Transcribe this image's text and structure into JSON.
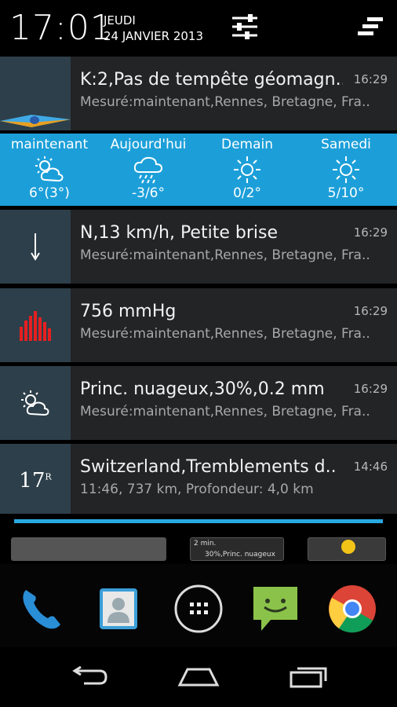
{
  "status": {
    "time": "17:01",
    "weekday": "JEUDI",
    "date": "24 JANVIER 2013"
  },
  "notifications": [
    {
      "title": "K:2,Pas de tempête géomagn..",
      "subtitle": "Mesuré:maintenant,Rennes, Bretagne, Fra..",
      "time": "16:29",
      "icon": "geomagnetic-icon"
    },
    {
      "title": "N,13 km/h, Petite brise",
      "subtitle": "Mesuré:maintenant,Rennes, Bretagne, Fra..",
      "time": "16:29",
      "icon": "wind-arrow-icon"
    },
    {
      "title": "756 mmHg",
      "subtitle": "Mesuré:maintenant,Rennes, Bretagne, Fra..",
      "time": "16:29",
      "icon": "pressure-bars-icon"
    },
    {
      "title": "Princ. nuageux,30%,0.2 mm",
      "subtitle": "Mesuré:maintenant,Rennes, Bretagne, Fra..",
      "time": "16:29",
      "icon": "partly-cloudy-icon"
    },
    {
      "title": "Switzerland,Tremblements d..",
      "subtitle": "11:46, 737 km, Profondeur: 4,0 km",
      "time": "14:46",
      "icon": "earthquake-icon",
      "icon_label": "17",
      "icon_label_sup": "R"
    }
  ],
  "forecast": [
    {
      "day": "maintenant",
      "temp": "6°(3°)",
      "icon": "partly-cloudy-icon"
    },
    {
      "day": "Aujourd'hui",
      "temp": "-3/6°",
      "icon": "rain-cloud-icon"
    },
    {
      "day": "Demain",
      "temp": "0/2°",
      "icon": "sun-icon"
    },
    {
      "day": "Samedi",
      "temp": "5/10°",
      "icon": "sun-icon"
    }
  ],
  "widgets": {
    "widget_2_line1": "2 min.",
    "widget_2_line2": "30%,Princ. nuageux"
  },
  "dock": [
    "phone-icon",
    "contacts-icon",
    "app-drawer-icon",
    "messaging-icon",
    "chrome-icon"
  ],
  "nav": [
    "back-icon",
    "home-icon",
    "recent-apps-icon"
  ],
  "colors": {
    "accent": "#1c9fd9",
    "panel": "#222426",
    "icon_bg": "#2d3f4a",
    "pressure": "#e52020"
  }
}
